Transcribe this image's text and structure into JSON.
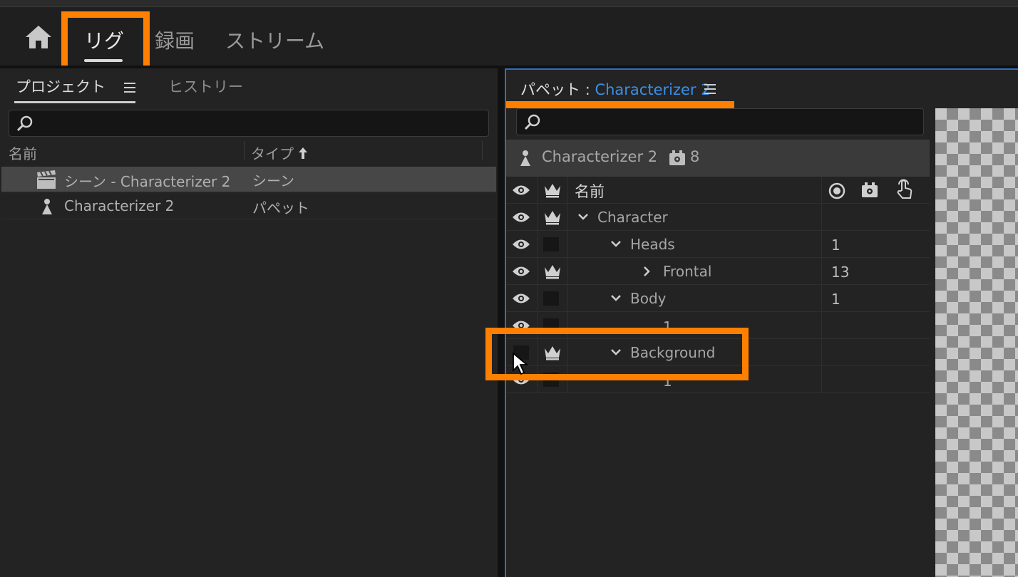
{
  "top_nav": {
    "tabs": [
      {
        "label": "リグ",
        "active": true
      },
      {
        "label": "録画",
        "active": false
      },
      {
        "label": "ストリーム",
        "active": false
      }
    ]
  },
  "project_panel": {
    "tabs": [
      {
        "label": "プロジェクト",
        "active": true
      },
      {
        "label": "ヒストリー",
        "active": false
      }
    ],
    "search_placeholder": "",
    "columns": {
      "name": "名前",
      "type": "タイプ"
    },
    "rows": [
      {
        "icon": "clapperboard-icon",
        "name": "シーン - Characterizer 2",
        "type": "シーン",
        "selected": true
      },
      {
        "icon": "puppet-icon",
        "name": "Characterizer 2",
        "type": "パペット",
        "selected": false
      }
    ]
  },
  "puppet_panel": {
    "title_label": "パペット",
    "title_sep": ":",
    "title_name": "Characterizer 2",
    "search_placeholder": "",
    "info": {
      "puppet_name": "Characterizer 2",
      "behavior_count": "8"
    },
    "columns": {
      "name": "名前"
    },
    "rows": [
      {
        "label": "Character",
        "indent": 0,
        "expanded": true,
        "eye": true,
        "crown": true,
        "count": ""
      },
      {
        "label": "Heads",
        "indent": 1,
        "expanded": true,
        "eye": true,
        "crown": false,
        "count": "1"
      },
      {
        "label": "Frontal",
        "indent": 2,
        "expanded": false,
        "eye": true,
        "crown": true,
        "count": "13"
      },
      {
        "label": "Body",
        "indent": 1,
        "expanded": true,
        "eye": true,
        "crown": false,
        "count": "1"
      },
      {
        "label": "1",
        "indent": 2,
        "leaf": true,
        "eye": true,
        "crown": false,
        "count": ""
      },
      {
        "label": "Background",
        "indent": 1,
        "expanded": true,
        "eye": false,
        "crown": true,
        "count": ""
      },
      {
        "label": "1",
        "indent": 2,
        "leaf": true,
        "eye": true,
        "crown": false,
        "count": ""
      }
    ]
  },
  "colors": {
    "highlight": "#ff7f00",
    "accent": "#3b8ee8"
  }
}
